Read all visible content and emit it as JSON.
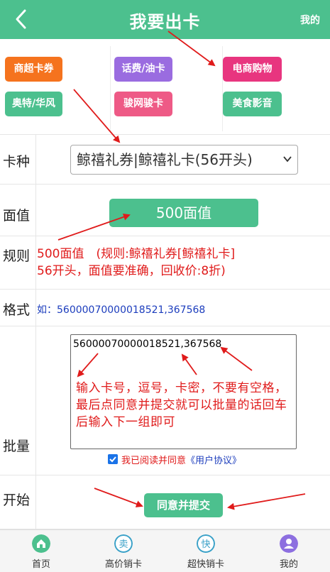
{
  "header": {
    "title": "我要出卡",
    "mine": "我的"
  },
  "categories": [
    {
      "label": "商超卡券",
      "color": "#f5731e"
    },
    {
      "label": "话费/油卡",
      "color": "#9a6ce0"
    },
    {
      "label": "电商购物",
      "color": "#e8357f"
    },
    {
      "label": "奥特/华风",
      "color": "#4cc08e"
    },
    {
      "label": "骏网骏卡",
      "color": "#ee5a86"
    },
    {
      "label": "美食影音",
      "color": "#4cc08e"
    }
  ],
  "form": {
    "card_type_label": "卡种",
    "card_type_value": "鲸禧礼券|鲸禧礼卡(56开头)",
    "face_label": "面值",
    "face_value": "500面值",
    "rule_label": "规则",
    "rule_line1": "500面值　(规则:鲸禧礼券[鲸禧礼卡]",
    "rule_line2": "56开头，面值要准确，回收价:8折)",
    "format_label": "格式",
    "format_text": "如：56000070000018521,367568",
    "batch_label": "批量",
    "batch_value": "56000070000018521,367568",
    "note": "输入卡号，逗号，卡密，不要有空格，最后点同意并提交就可以批量的话回车后输入下一组即可",
    "agree_text": "我已阅读并同意",
    "agree_link": "《用户协议》",
    "start_label": "开始",
    "submit_label": "同意并提交"
  },
  "nav": [
    {
      "label": "首页",
      "icon": "home-icon",
      "color": "#4cc08e"
    },
    {
      "label": "高价销卡",
      "icon": "sell-icon",
      "color": "#3aa1c8",
      "glyph": "卖"
    },
    {
      "label": "超快销卡",
      "icon": "fast-icon",
      "color": "#3aa1c8",
      "glyph": "快"
    },
    {
      "label": "我的",
      "icon": "user-icon",
      "color": "#8d6fe0"
    }
  ]
}
